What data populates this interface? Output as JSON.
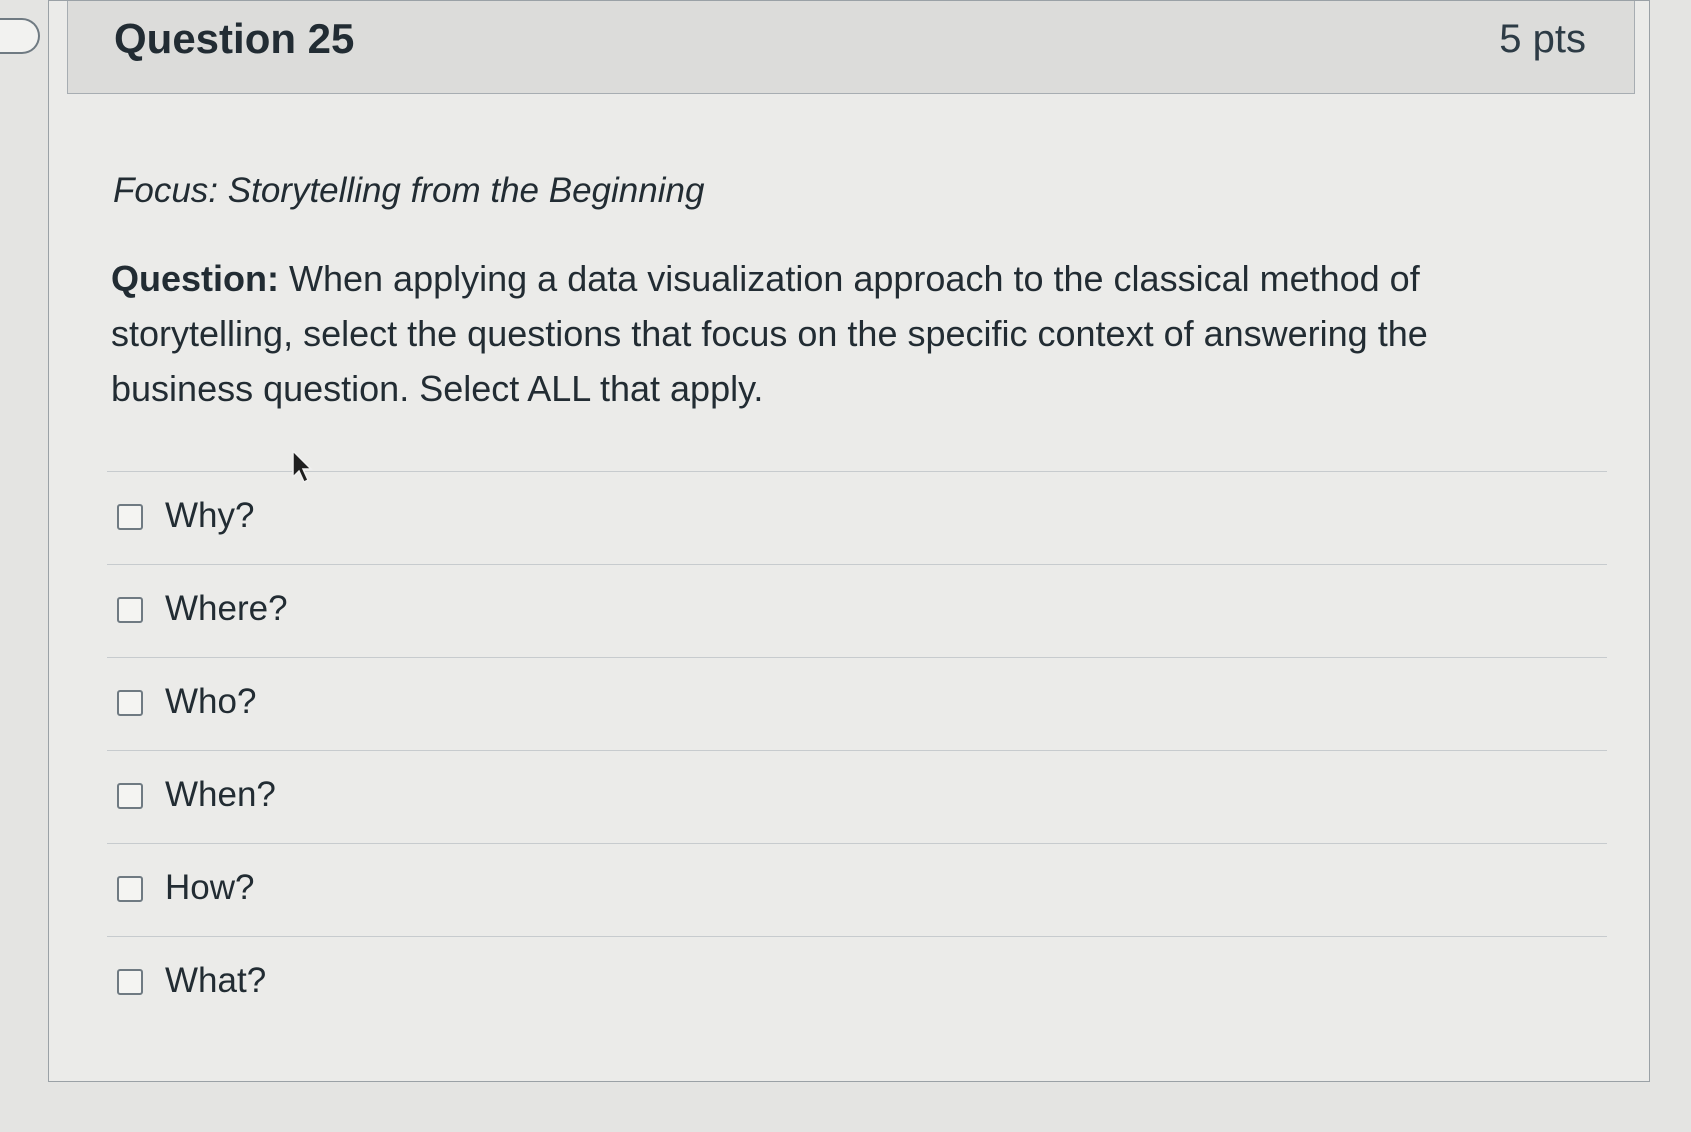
{
  "question": {
    "title": "Question 25",
    "points": "5 pts",
    "focus": "Focus: Storytelling from the Beginning",
    "label": "Question:",
    "text": "When applying a data visualization approach to the classical method of storytelling, select the questions that focus on the specific context of answering the business question. Select ALL that apply."
  },
  "answers": [
    {
      "label": "Why?",
      "checked": false
    },
    {
      "label": "Where?",
      "checked": false
    },
    {
      "label": "Who?",
      "checked": false
    },
    {
      "label": "When?",
      "checked": false
    },
    {
      "label": "How?",
      "checked": false
    },
    {
      "label": "What?",
      "checked": false
    }
  ],
  "icons": {
    "flag": "flag-question-icon",
    "cursor": "mouse-pointer-icon"
  }
}
